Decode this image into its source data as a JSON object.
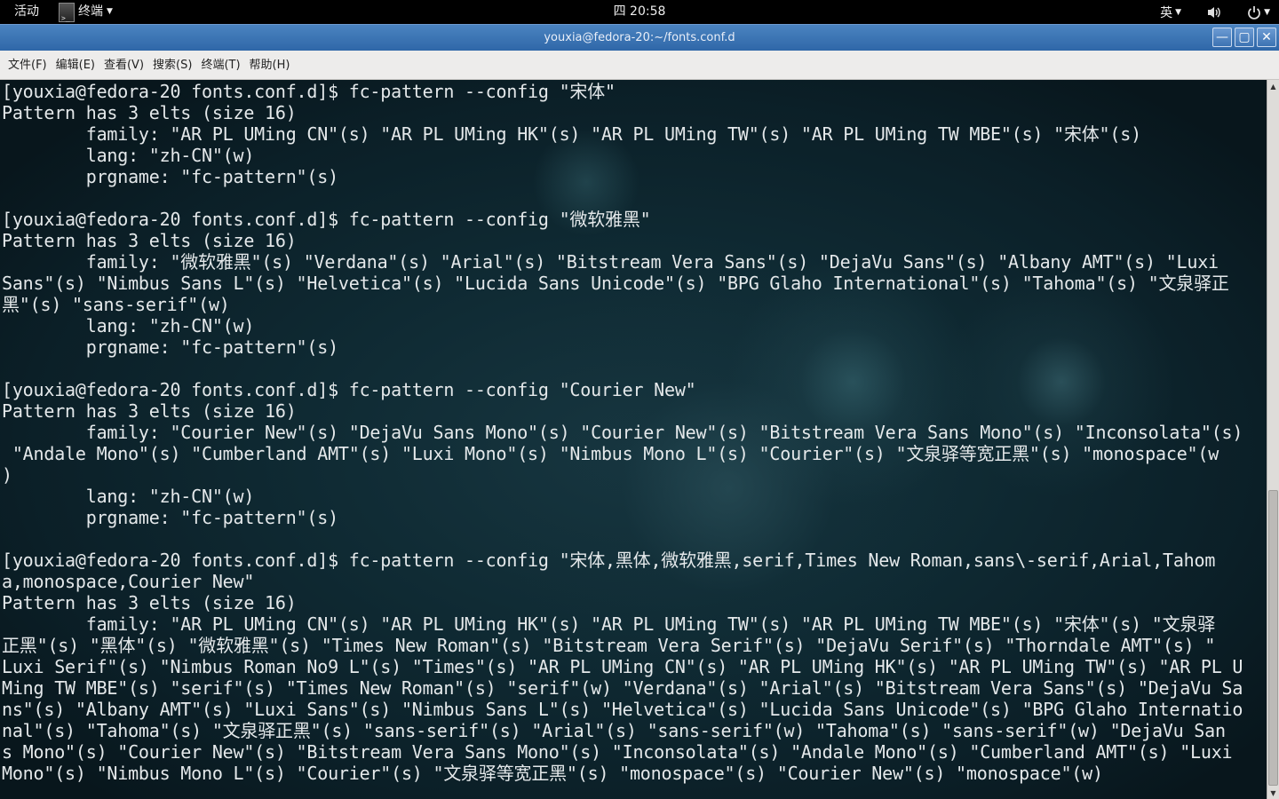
{
  "topbar": {
    "activities": "活动",
    "app_name": "终端",
    "clock": "四 20:58",
    "input_method": "英"
  },
  "window": {
    "title": "youxia@fedora-20:~/fonts.conf.d"
  },
  "menubar": {
    "items": [
      "文件(F)",
      "编辑(E)",
      "查看(V)",
      "搜索(S)",
      "终端(T)",
      "帮助(H)"
    ]
  },
  "terminal": {
    "lines": [
      "[youxia@fedora-20 fonts.conf.d]$ fc-pattern --config \"宋体\"",
      "Pattern has 3 elts (size 16)",
      "        family: \"AR PL UMing CN\"(s) \"AR PL UMing HK\"(s) \"AR PL UMing TW\"(s) \"AR PL UMing TW MBE\"(s) \"宋体\"(s)",
      "        lang: \"zh-CN\"(w)",
      "        prgname: \"fc-pattern\"(s)",
      "",
      "[youxia@fedora-20 fonts.conf.d]$ fc-pattern --config \"微软雅黑\"",
      "Pattern has 3 elts (size 16)",
      "        family: \"微软雅黑\"(s) \"Verdana\"(s) \"Arial\"(s) \"Bitstream Vera Sans\"(s) \"DejaVu Sans\"(s) \"Albany AMT\"(s) \"Luxi",
      "Sans\"(s) \"Nimbus Sans L\"(s) \"Helvetica\"(s) \"Lucida Sans Unicode\"(s) \"BPG Glaho International\"(s) \"Tahoma\"(s) \"文泉驿正",
      "黑\"(s) \"sans-serif\"(w)",
      "        lang: \"zh-CN\"(w)",
      "        prgname: \"fc-pattern\"(s)",
      "",
      "[youxia@fedora-20 fonts.conf.d]$ fc-pattern --config \"Courier New\"",
      "Pattern has 3 elts (size 16)",
      "        family: \"Courier New\"(s) \"DejaVu Sans Mono\"(s) \"Courier New\"(s) \"Bitstream Vera Sans Mono\"(s) \"Inconsolata\"(s)",
      " \"Andale Mono\"(s) \"Cumberland AMT\"(s) \"Luxi Mono\"(s) \"Nimbus Mono L\"(s) \"Courier\"(s) \"文泉驿等宽正黑\"(s) \"monospace\"(w",
      ")",
      "        lang: \"zh-CN\"(w)",
      "        prgname: \"fc-pattern\"(s)",
      "",
      "[youxia@fedora-20 fonts.conf.d]$ fc-pattern --config \"宋体,黑体,微软雅黑,serif,Times New Roman,sans\\-serif,Arial,Tahom",
      "a,monospace,Courier New\"",
      "Pattern has 3 elts (size 16)",
      "        family: \"AR PL UMing CN\"(s) \"AR PL UMing HK\"(s) \"AR PL UMing TW\"(s) \"AR PL UMing TW MBE\"(s) \"宋体\"(s) \"文泉驿",
      "正黑\"(s) \"黑体\"(s) \"微软雅黑\"(s) \"Times New Roman\"(s) \"Bitstream Vera Serif\"(s) \"DejaVu Serif\"(s) \"Thorndale AMT\"(s) \"",
      "Luxi Serif\"(s) \"Nimbus Roman No9 L\"(s) \"Times\"(s) \"AR PL UMing CN\"(s) \"AR PL UMing HK\"(s) \"AR PL UMing TW\"(s) \"AR PL U",
      "Ming TW MBE\"(s) \"serif\"(s) \"Times New Roman\"(s) \"serif\"(w) \"Verdana\"(s) \"Arial\"(s) \"Bitstream Vera Sans\"(s) \"DejaVu Sa",
      "ns\"(s) \"Albany AMT\"(s) \"Luxi Sans\"(s) \"Nimbus Sans L\"(s) \"Helvetica\"(s) \"Lucida Sans Unicode\"(s) \"BPG Glaho Internatio",
      "nal\"(s) \"Tahoma\"(s) \"文泉驿正黑\"(s) \"sans-serif\"(s) \"Arial\"(s) \"sans-serif\"(w) \"Tahoma\"(s) \"sans-serif\"(w) \"DejaVu San",
      "s Mono\"(s) \"Courier New\"(s) \"Bitstream Vera Sans Mono\"(s) \"Inconsolata\"(s) \"Andale Mono\"(s) \"Cumberland AMT\"(s) \"Luxi",
      "Mono\"(s) \"Nimbus Mono L\"(s) \"Courier\"(s) \"文泉驿等宽正黑\"(s) \"monospace\"(s) \"Courier New\"(s) \"monospace\"(w)"
    ]
  },
  "icons": {
    "app": "terminal-icon",
    "volume": "volume-icon",
    "power": "power-icon",
    "minimize": "minimize-icon",
    "maximize": "maximize-icon",
    "close": "close-icon"
  }
}
